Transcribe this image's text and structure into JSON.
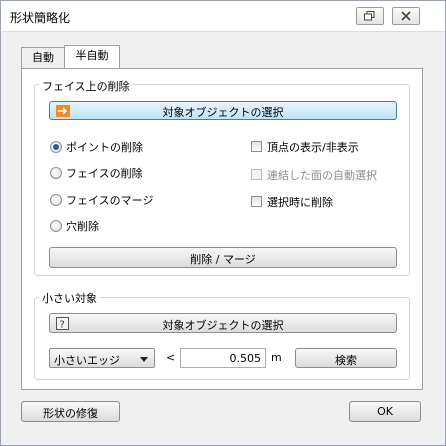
{
  "window": {
    "title": "形状簡略化"
  },
  "tabs": [
    {
      "label": "自動",
      "active": false
    },
    {
      "label": "半自動",
      "active": true
    }
  ],
  "face_group": {
    "title": "フェイス上の削除",
    "select_button": "対象オブジェクトの選択",
    "select_icon": "arrow-right-icon",
    "radios": [
      {
        "label": "ポイントの削除",
        "checked": true
      },
      {
        "label": "フェイスの削除",
        "checked": false
      },
      {
        "label": "フェイスのマージ",
        "checked": false
      },
      {
        "label": "穴削除",
        "checked": false
      }
    ],
    "checkboxes": [
      {
        "label": "頂点の表示/非表示",
        "checked": false,
        "enabled": true
      },
      {
        "label": "連結した面の自動選択",
        "checked": false,
        "enabled": false
      },
      {
        "label": "選択時に削除",
        "checked": false,
        "enabled": true
      }
    ],
    "action_button": "削除 / マージ"
  },
  "small_group": {
    "title": "小さい対象",
    "select_button": "対象オブジェクトの選択",
    "select_icon": "question-icon",
    "dropdown_value": "小さいエッジ",
    "operator": "<",
    "value": "0.505",
    "unit": "m",
    "search_button": "検索"
  },
  "footer": {
    "repair_button": "形状の修復",
    "ok_button": "OK"
  },
  "colors": {
    "accent_button": "#bfe3f8",
    "icon_orange": "#f08a24",
    "radio_dot": "#2d5aa0"
  }
}
